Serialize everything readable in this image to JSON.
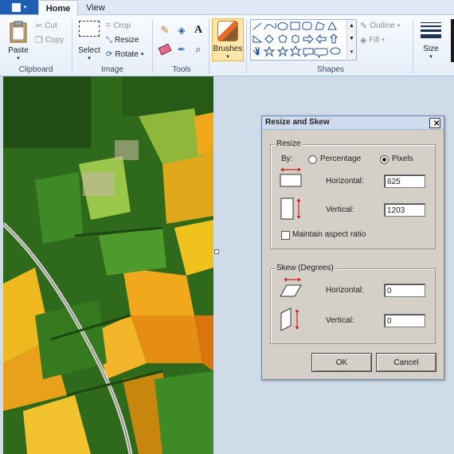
{
  "ribbon": {
    "tabs": {
      "file_icon": "file-menu-icon",
      "home": "Home",
      "view": "View"
    },
    "clipboard": {
      "label": "Clipboard",
      "paste": "Paste",
      "cut": "Cut",
      "copy": "Copy"
    },
    "image": {
      "label": "Image",
      "select": "Select",
      "crop": "Crop",
      "resize": "Resize",
      "rotate": "Rotate"
    },
    "tools": {
      "label": "Tools"
    },
    "brushes": {
      "label": "Brushes"
    },
    "shapes": {
      "label": "Shapes",
      "outline": "Outline",
      "fill": "Fill"
    },
    "size": {
      "label": "Size"
    }
  },
  "dialog": {
    "title": "Resize and Skew",
    "resize": {
      "legend": "Resize",
      "by_label": "By:",
      "percentage_label": "Percentage",
      "pixels_label": "Pixels",
      "selected_mode": "Pixels",
      "horizontal_label": "Horizontal:",
      "horizontal_value": "625",
      "vertical_label": "Vertical:",
      "vertical_value": "1203",
      "maintain_label": "Maintain aspect ratio",
      "maintain_checked": false
    },
    "skew": {
      "legend": "Skew (Degrees)",
      "horizontal_label": "Horizontal:",
      "horizontal_value": "0",
      "vertical_label": "Vertical:",
      "vertical_value": "0"
    },
    "ok": "OK",
    "cancel": "Cancel"
  },
  "colors": {
    "accent": "#1e5fb3",
    "ribbon": "#eef3fa",
    "workspace": "#cfdbe9",
    "dialog": "#d4d0c8"
  }
}
